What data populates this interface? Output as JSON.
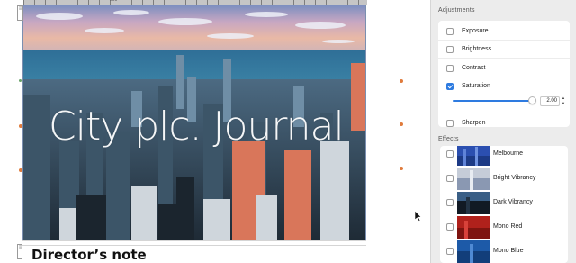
{
  "canvas": {
    "photo_title": "City plc. Journal",
    "text_frame_heading": "Director’s note",
    "ruler_label": "500"
  },
  "panel": {
    "adjustments_title": "Adjustments",
    "adjustments": [
      {
        "label": "Exposure",
        "checked": false
      },
      {
        "label": "Brightness",
        "checked": false
      },
      {
        "label": "Contrast",
        "checked": false
      },
      {
        "label": "Saturation",
        "checked": true
      },
      {
        "label": "Sharpen",
        "checked": false
      }
    ],
    "saturation_value": "2.00",
    "saturation_slider_level": 0.94,
    "effects_title": "Effects",
    "effects": [
      {
        "label": "Melbourne",
        "checked": false
      },
      {
        "label": "Bright Vibrancy",
        "checked": false
      },
      {
        "label": "Dark Vibrancy",
        "checked": false
      },
      {
        "label": "Mono Red",
        "checked": false
      },
      {
        "label": "Mono Blue",
        "checked": false
      }
    ]
  },
  "colors": {
    "accent": "#2e7be0",
    "handle": "#e07b3c"
  }
}
